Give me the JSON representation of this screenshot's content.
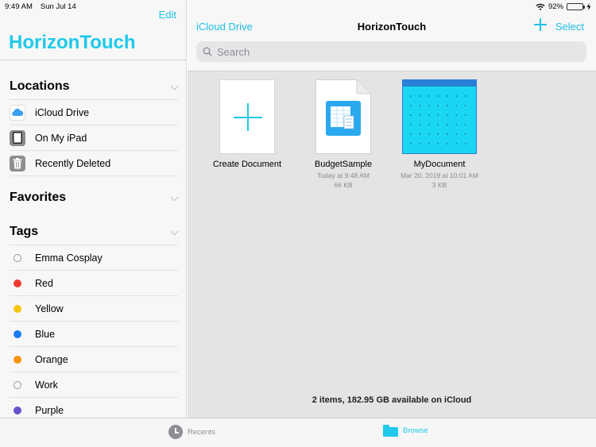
{
  "status_bar": {
    "time": "9:49 AM",
    "date": "Sun Jul 14",
    "battery": "92%",
    "battery_level": 0.92
  },
  "sidebar": {
    "edit_label": "Edit",
    "app_title": "HorizonTouch",
    "locations_title": "Locations",
    "locations": [
      {
        "label": "iCloud Drive",
        "icon": "icloud-icon"
      },
      {
        "label": "On My iPad",
        "icon": "ipad-icon"
      },
      {
        "label": "Recently Deleted",
        "icon": "trash-icon"
      }
    ],
    "favorites_title": "Favorites",
    "tags_title": "Tags",
    "tags": [
      {
        "label": "Emma Cosplay",
        "color": "",
        "hollow": true
      },
      {
        "label": "Red",
        "color": "#f23b30",
        "hollow": false
      },
      {
        "label": "Yellow",
        "color": "#f7c60a",
        "hollow": false
      },
      {
        "label": "Blue",
        "color": "#1b7cf2",
        "hollow": false
      },
      {
        "label": "Orange",
        "color": "#f7930c",
        "hollow": false
      },
      {
        "label": "Work",
        "color": "",
        "hollow": true
      },
      {
        "label": "Purple",
        "color": "#6a52cf",
        "hollow": false
      }
    ]
  },
  "navbar": {
    "back_label": "iCloud Drive",
    "title": "HorizonTouch",
    "select_label": "Select"
  },
  "search": {
    "placeholder": "Search"
  },
  "items": [
    {
      "name": "Create Document"
    },
    {
      "name": "BudgetSample",
      "date": "Today at 9:48 AM",
      "size": "66 KB"
    },
    {
      "name": "MyDocument",
      "date": "Mar 20, 2019 at 10:01 AM",
      "size": "3 KB"
    }
  ],
  "footer": {
    "info": "2 items, 182.95 GB available on iCloud"
  },
  "tabbar": {
    "recents_label": "Recents",
    "browse_label": "Browse"
  },
  "colors": {
    "accent": "#1ec9ea",
    "link": "#1fc0e6"
  }
}
